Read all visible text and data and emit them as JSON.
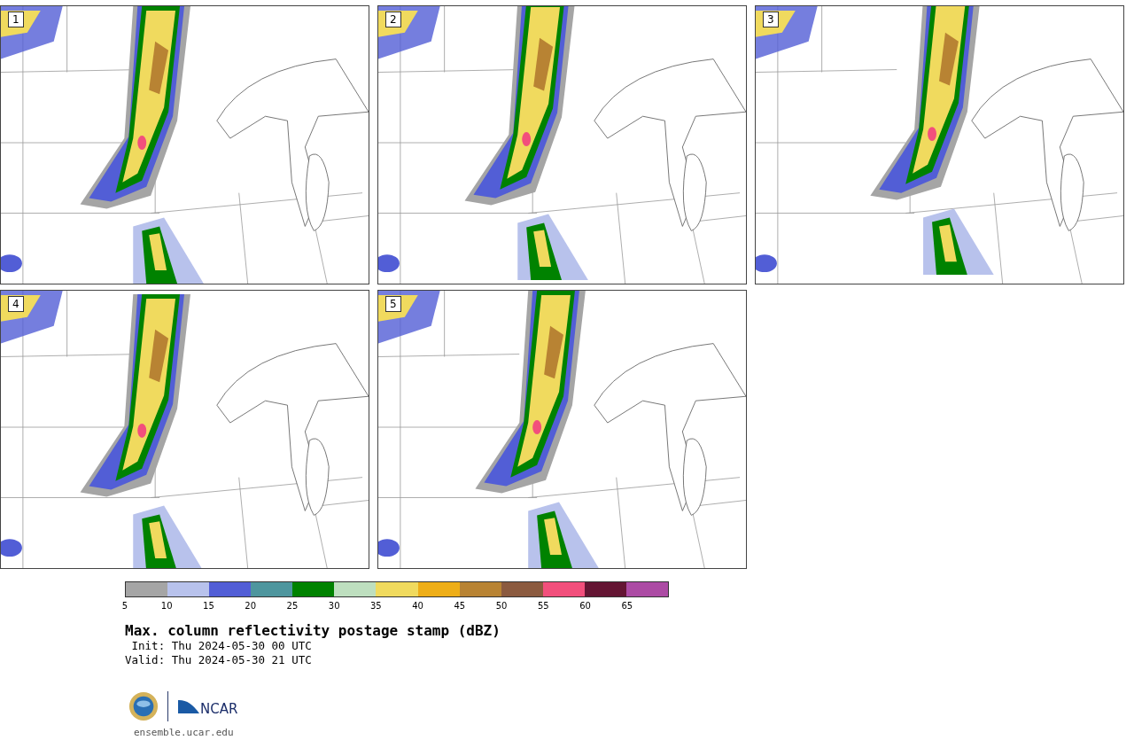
{
  "panels": [
    {
      "label": "1"
    },
    {
      "label": "2"
    },
    {
      "label": "3"
    },
    {
      "label": "4"
    },
    {
      "label": "5"
    }
  ],
  "colorbar": {
    "segments": [
      {
        "color": "#a5a5a5"
      },
      {
        "color": "#b8c2ec"
      },
      {
        "color": "#525ed6"
      },
      {
        "color": "#4e969e"
      },
      {
        "color": "#008200"
      },
      {
        "color": "#bedfbf"
      },
      {
        "color": "#f0da5e"
      },
      {
        "color": "#eeae18"
      },
      {
        "color": "#b88333"
      },
      {
        "color": "#8b5a3f"
      },
      {
        "color": "#f24f7c"
      },
      {
        "color": "#641533"
      },
      {
        "color": "#ac4ba4"
      }
    ],
    "ticks": [
      "5",
      "10",
      "15",
      "20",
      "25",
      "30",
      "35",
      "40",
      "45",
      "50",
      "55",
      "60",
      "65"
    ]
  },
  "title": "Max. column reflectivity postage stamp (dBZ)",
  "init": " Init: Thu 2024-05-30 00 UTC",
  "valid": "Valid: Thu 2024-05-30 21 UTC",
  "logos": {
    "ncar": "NCAR"
  },
  "link": "ensemble.ucar.edu"
}
